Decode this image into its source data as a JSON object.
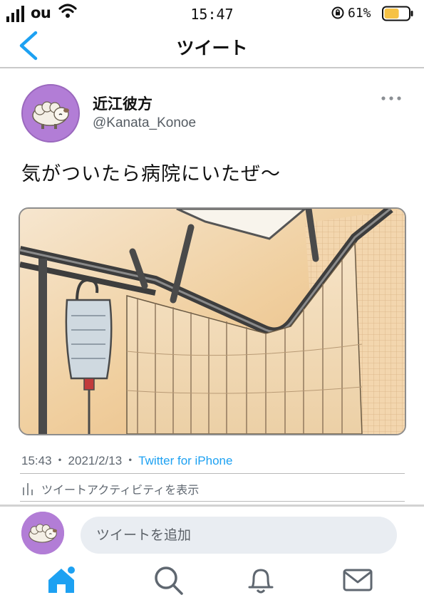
{
  "status_bar": {
    "carrier": "ou",
    "time": "15:47",
    "battery_percent": "61%",
    "battery_level": 0.61,
    "icons": [
      "signal-icon",
      "wifi-icon",
      "orientation-lock-icon",
      "battery-icon"
    ]
  },
  "header": {
    "title": "ツイート",
    "back_icon": "chevron-left-icon"
  },
  "tweet": {
    "display_name": "近江彼方",
    "handle": "@Kanata_Konoe",
    "text": "気がついたら病院にいたぜ〜",
    "time": "15:43",
    "date": "2021/2/13",
    "separator": "・",
    "source": "Twitter for iPhone",
    "activity_label": "ツイートアクティビティを表示",
    "more_icon": "more-horizontal-icon",
    "image_description_icon": "hospital-room-illustration"
  },
  "reply": {
    "placeholder": "ツイートを追加"
  },
  "tabs": [
    {
      "icon": "home-icon",
      "active": true
    },
    {
      "icon": "search-icon",
      "active": false
    },
    {
      "icon": "notifications-bell-icon",
      "active": false
    },
    {
      "icon": "messages-envelope-icon",
      "active": false
    }
  ],
  "colors": {
    "accent": "#1da1f2",
    "avatar_bg": "#b27dd6",
    "battery_fill": "#f6c245"
  }
}
